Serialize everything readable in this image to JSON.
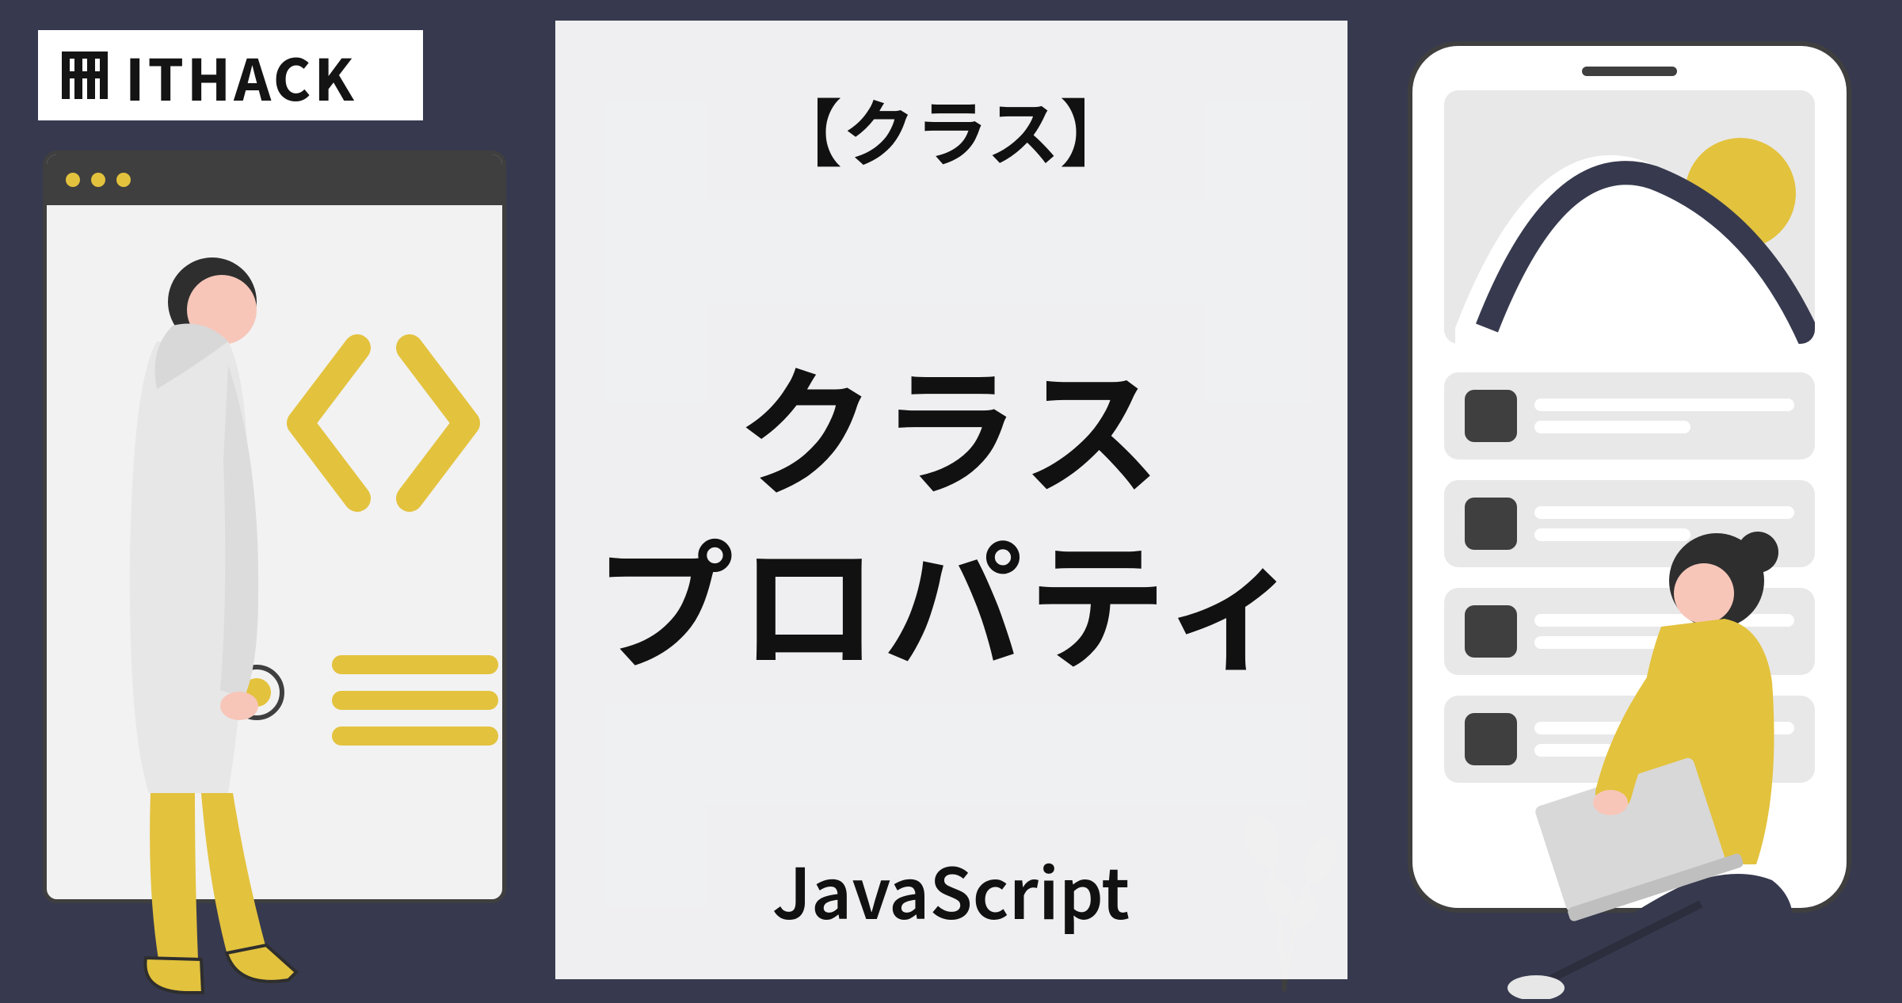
{
  "logo": {
    "text": "ITHACK"
  },
  "card": {
    "supertitle": "【クラス】",
    "title_line1": "クラス",
    "title_line2": "プロパティ",
    "subtitle": "JavaScript"
  },
  "colors": {
    "bg": "#373a4e",
    "accent": "#e3c23d",
    "dark": "#3f3f3f",
    "skin": "#f7c6b9",
    "hoodie": "#e7e7e7"
  }
}
